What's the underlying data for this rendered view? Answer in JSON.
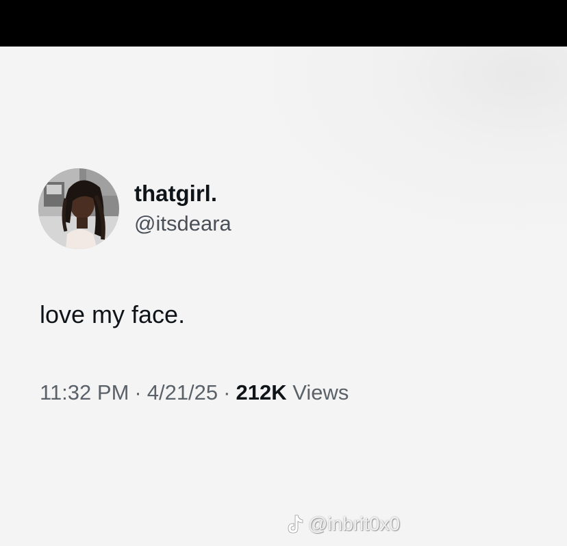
{
  "tweet": {
    "display_name": "thatgirl.",
    "handle": "@itsdeara",
    "text": "love my face.",
    "time": "11:32 PM",
    "separator": "·",
    "date": "4/21/25",
    "views_count": "212K",
    "views_label": "Views"
  },
  "avatar": {
    "icon": "profile-photo"
  },
  "watermark": {
    "icon": "tiktok-icon",
    "text": "@inbrit0x0"
  },
  "colors": {
    "background": "#f4f4f4",
    "text_primary": "#0f1419",
    "text_secondary": "#5b6169",
    "top_bar": "#000000"
  }
}
